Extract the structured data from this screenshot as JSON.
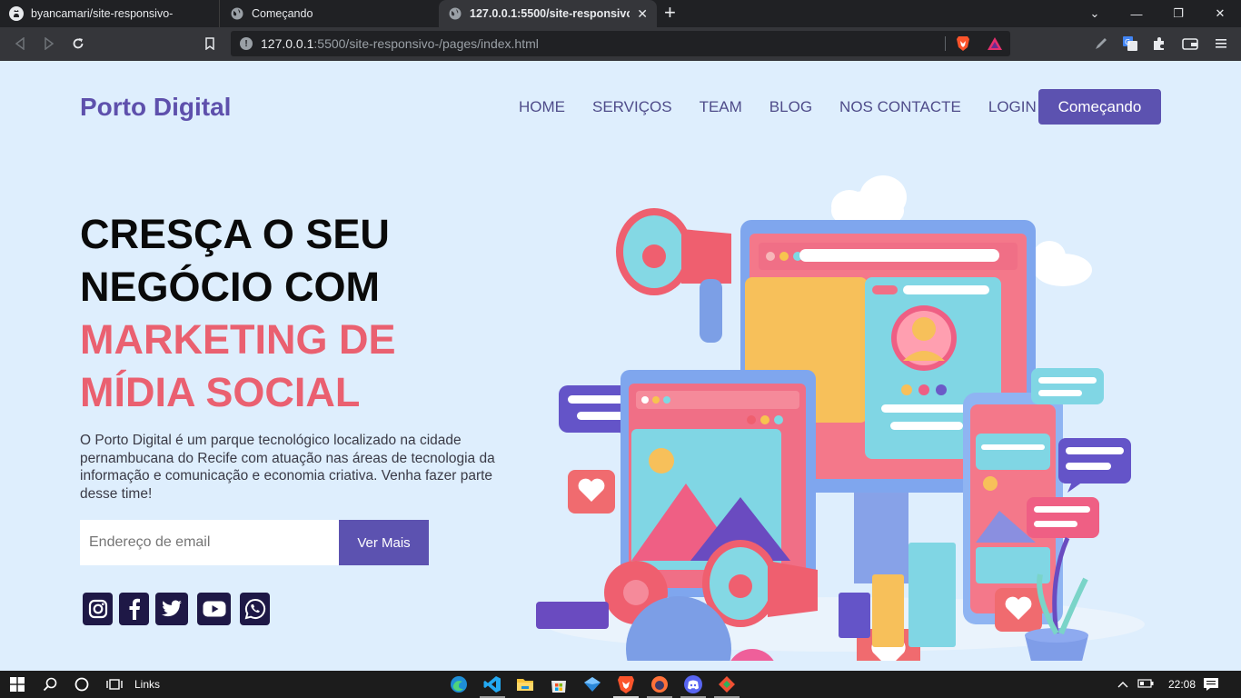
{
  "browser": {
    "tabs": [
      {
        "title": "byancamari/site-responsivo-",
        "icon": "github-icon"
      },
      {
        "title": "Começando",
        "icon": "globe-icon"
      },
      {
        "title": "127.0.0.1:5500/site-responsivo-/pages/index.html",
        "icon": "globe-icon",
        "active": true
      }
    ],
    "address": {
      "host": "127.0.0.1",
      "rest": ":5500/site-responsivo-/pages/index.html"
    }
  },
  "site": {
    "logo": "Porto Digital",
    "nav": [
      "HOME",
      "SERVIÇOS",
      "TEAM",
      "BLOG",
      "NOS CONTACTE",
      "LOGIN"
    ],
    "cta_label": "Começando",
    "headline": {
      "line1": "CRESÇA O SEU",
      "line2": "NEGÓCIO COM",
      "line3": "MARKETING DE",
      "line4": "MÍDIA SOCIAL"
    },
    "description": "O Porto Digital é um parque tecnológico localizado na cidade pernambucana do Recife com atuação nas áreas de tecnologia da informação e comunicação e economia criativa. Venha fazer parte desse time!",
    "email_placeholder": "Endereço de email",
    "button_label": "Ver Mais",
    "social": [
      "instagram-icon",
      "facebook-icon",
      "twitter-icon",
      "youtube-icon",
      "whatsapp-icon"
    ],
    "colors": {
      "primary": "#5c52b0",
      "accent": "#ea6070",
      "background": "#deeefd",
      "social_bg": "#1e1846"
    }
  },
  "taskbar": {
    "links_label": "Links",
    "time": "22:08"
  }
}
